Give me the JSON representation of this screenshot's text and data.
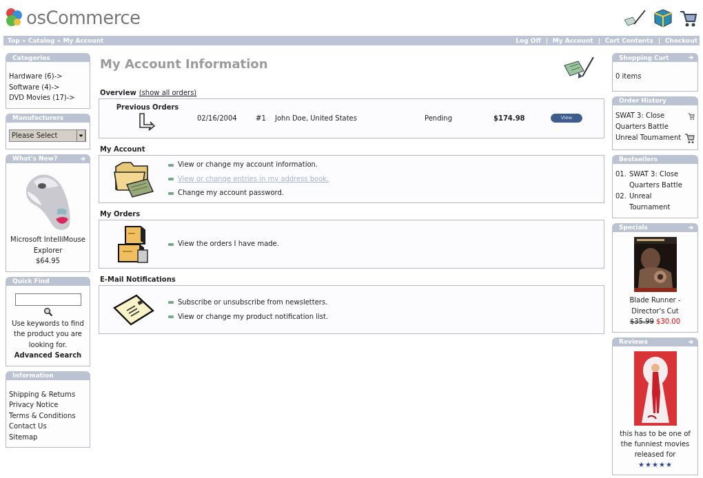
{
  "header": {
    "logo": "osCommerce",
    "breadcrumb": "Top » Catalog » My Account",
    "links": [
      "Log Off",
      "My Account",
      "Cart Contents",
      "Checkout"
    ]
  },
  "left_boxes": [
    {
      "kind": "links",
      "title": "Categories",
      "arrow": false,
      "items": [
        "Hardware (6)->",
        "Software (4)->",
        "DVD Movies (17)->"
      ]
    },
    {
      "kind": "select",
      "title": "Manufacturers",
      "arrow": false,
      "value": "Please Select"
    },
    {
      "kind": "product",
      "title": "What's New?",
      "arrow": true,
      "name": "Microsoft IntelliMouse Explorer",
      "price": "$64.95"
    },
    {
      "kind": "search",
      "title": "Quick Find",
      "arrow": false,
      "hint": "Use keywords to find the product you are looking for.",
      "link": "Advanced Search"
    },
    {
      "kind": "links",
      "title": "Information",
      "arrow": false,
      "items": [
        "Shipping & Returns",
        "Privacy Notice",
        "Terms & Conditions",
        "Contact Us",
        "Sitemap"
      ]
    }
  ],
  "main": {
    "title": "My Account Information",
    "overview": {
      "heading": "Overview",
      "link": "(show all orders)",
      "label": "Previous Orders",
      "orders": [
        {
          "date": "02/16/2004",
          "number": "#1",
          "name": "John Doe, United States",
          "status": "Pending",
          "total": "$174.98",
          "button": "View"
        }
      ]
    },
    "sections": [
      {
        "kind": "account",
        "heading": "My Account",
        "links": [
          {
            "text": "View or change my account information.",
            "visited": false
          },
          {
            "text": "View or change entries in my address book.",
            "visited": true
          },
          {
            "text": "Change my account password.",
            "visited": false
          }
        ]
      },
      {
        "kind": "orders",
        "heading": "My Orders",
        "links": [
          {
            "text": "View the orders I have made.",
            "visited": false
          }
        ]
      },
      {
        "kind": "notifications",
        "heading": "E-Mail Notifications",
        "links": [
          {
            "text": "Subscribe or unsubscribe from newsletters.",
            "visited": false
          },
          {
            "text": "View or change my product notification list.",
            "visited": false
          }
        ]
      }
    ]
  },
  "right_boxes": [
    {
      "kind": "text",
      "title": "Shopping Cart",
      "arrow": true,
      "text": "0 items"
    },
    {
      "kind": "history",
      "title": "Order History",
      "arrow": false,
      "items": [
        "SWAT 3: Close Quarters Battle",
        "Unreal Tournament"
      ]
    },
    {
      "kind": "ranked",
      "title": "Bestsellers",
      "arrow": false,
      "items": [
        {
          "rank": "01.",
          "name": "SWAT 3: Close Quarters Battle"
        },
        {
          "rank": "02.",
          "name": "Unreal Tournament"
        }
      ]
    },
    {
      "kind": "special",
      "title": "Specials",
      "arrow": true,
      "name": "Blade Runner - Director's Cut",
      "old_price": "$35.99",
      "price": "$30.00"
    },
    {
      "kind": "review",
      "title": "Reviews",
      "arrow": true,
      "text": "this has to be one of the funniest movies released for",
      "stars": 5
    }
  ]
}
